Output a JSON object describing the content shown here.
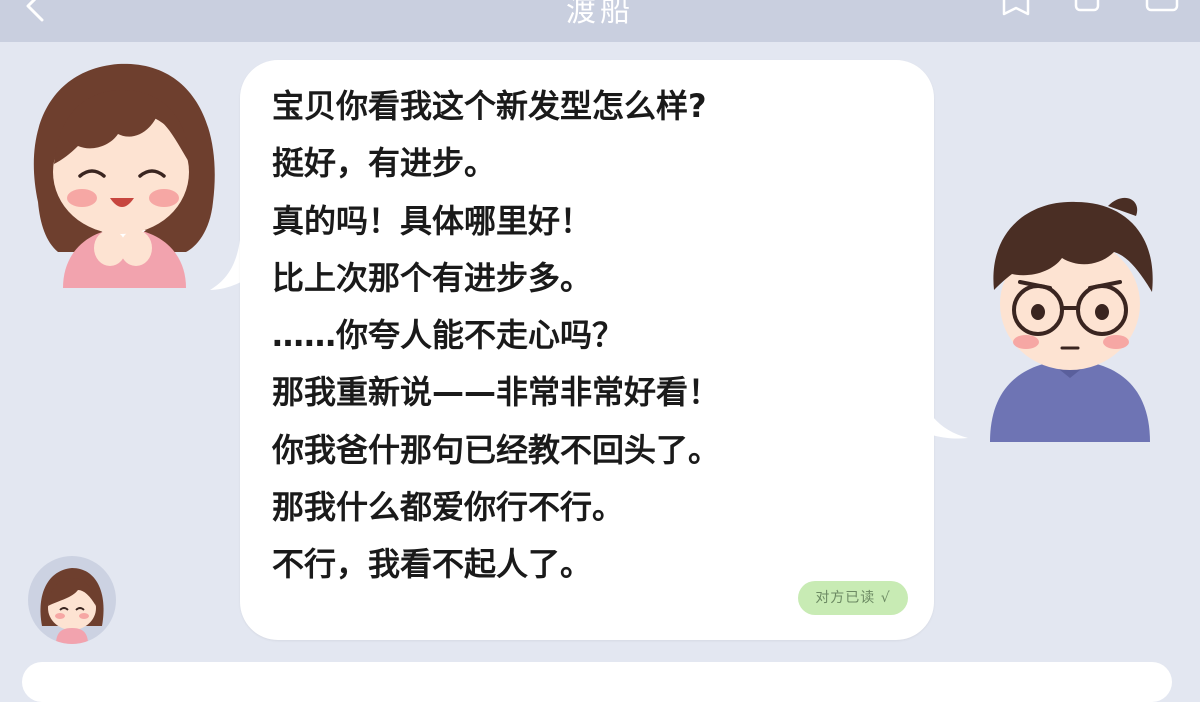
{
  "header": {
    "title": "渡船"
  },
  "message": {
    "lines": [
      "宝贝你看我这个新发型怎么样?",
      "挺好，有进步。",
      "真的吗！具体哪里好！",
      "比上次那个有进步多。",
      "……你夸人能不走心吗？",
      "那我重新说——非常非常好看！",
      "你我爸什那句已经教不回头了。",
      "那我什么都爱你行不行。",
      "不行，我看不起人了。"
    ],
    "read_badge": "对方已读 √"
  },
  "colors": {
    "background": "#e3e7f1",
    "topbar": "#c9cfdf",
    "bubble": "#ffffff",
    "read_badge": "#c8ebb4"
  },
  "icons": {
    "back": "back-arrow-icon",
    "top_right": [
      "contacts-icon",
      "chat-icon",
      "menu-icon"
    ]
  }
}
